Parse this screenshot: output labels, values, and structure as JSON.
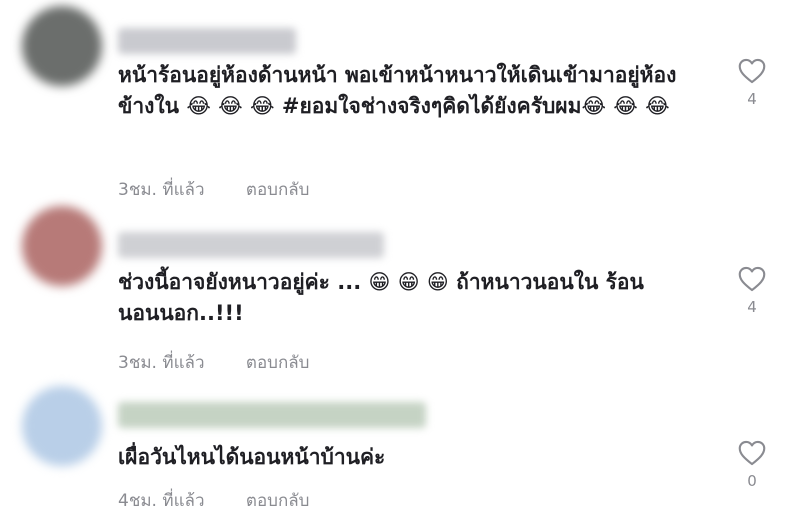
{
  "comments": [
    {
      "text": "หน้าร้อนอยู่ห้องด้านหน้า พอเข้าหน้าหนาวให้เดินเข้ามาอยู่ห้องข้างใน 😂 😂 😂  #ยอมใจช่างจริงๆคิดได้ยังครับผม😂 😂 😂",
      "time": "3ชม. ที่แล้ว",
      "reply_label": "ตอบกลับ",
      "likes": "4",
      "avatar_color": "#6b6e6c",
      "username_color": "#c9cacf"
    },
    {
      "text": "ช่วงนี้อาจยังหนาวอยู่ค่ะ ... 😁 😁 😁 ถ้าหนาวนอนใน ร้อนนอนนอก..!!!",
      "time": "3ชม. ที่แล้ว",
      "reply_label": "ตอบกลับ",
      "likes": "4",
      "avatar_color": "#b77a78",
      "username_color": "#cfd0d4"
    },
    {
      "text": "เผื่อวันไหนได้นอนหน้าบ้านค่ะ",
      "time": "4ชม. ที่แล้ว",
      "reply_label": "ตอบกลับ",
      "likes": "0",
      "avatar_color": "#b9cfe8",
      "username_color": "#c5d3c4"
    }
  ],
  "icons": {
    "like": "heart-outline-icon"
  }
}
